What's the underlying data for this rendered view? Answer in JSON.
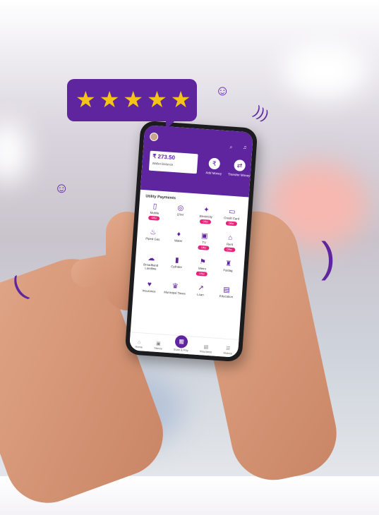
{
  "rating": {
    "stars": 5,
    "max": 5,
    "star_color": "#f6c419"
  },
  "app": {
    "brand_color": "#5f259f",
    "balance": "₹ 273.50",
    "balance_label": "Wallet Balance",
    "actions": [
      {
        "label": "Add Money"
      },
      {
        "label": "Transfer Money"
      }
    ],
    "section_title": "Utility Payments",
    "tiles": [
      {
        "label": "Mobile",
        "icon": "phone",
        "tag": "Offer"
      },
      {
        "label": "DTH",
        "icon": "dish",
        "tag": ""
      },
      {
        "label": "Electricity",
        "icon": "bulb",
        "tag": "Offer"
      },
      {
        "label": "Credit Card",
        "icon": "card",
        "tag": "Offer"
      },
      {
        "label": "Piped Gas",
        "icon": "flame",
        "tag": ""
      },
      {
        "label": "Water",
        "icon": "drop",
        "tag": ""
      },
      {
        "label": "TV",
        "icon": "tv",
        "tag": "Offer"
      },
      {
        "label": "Rent",
        "icon": "home",
        "tag": "Offer"
      },
      {
        "label": "Broadband Landline",
        "icon": "router",
        "tag": ""
      },
      {
        "label": "Cylinder",
        "icon": "cylinder",
        "tag": ""
      },
      {
        "label": "Metro",
        "icon": "train",
        "tag": "Offer"
      },
      {
        "label": "Fastag",
        "icon": "car",
        "tag": ""
      },
      {
        "label": "Insurance",
        "icon": "shield",
        "tag": ""
      },
      {
        "label": "Municipal Taxes",
        "icon": "building",
        "tag": ""
      },
      {
        "label": "Loan",
        "icon": "chart",
        "tag": ""
      },
      {
        "label": "Education",
        "icon": "book",
        "tag": ""
      }
    ],
    "nav": [
      {
        "label": "Home",
        "icon": "⌂"
      },
      {
        "label": "Stores",
        "icon": "▣"
      },
      {
        "label": "Scan & Pay",
        "icon": "▦"
      },
      {
        "label": "Insurance",
        "icon": "▤"
      },
      {
        "label": "History",
        "icon": "☰"
      }
    ]
  }
}
